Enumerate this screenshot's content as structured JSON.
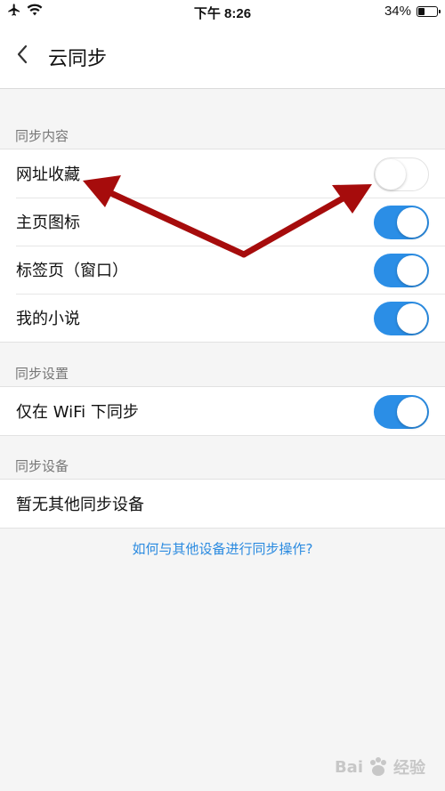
{
  "status_bar": {
    "time": "下午 8:26",
    "battery": "34%",
    "battery_level": 0.34
  },
  "nav": {
    "title": "云同步"
  },
  "sections": {
    "content": {
      "header": "同步内容",
      "items": [
        {
          "label": "网址收藏",
          "enabled": false
        },
        {
          "label": "主页图标",
          "enabled": true
        },
        {
          "label": "标签页（窗口）",
          "enabled": true
        },
        {
          "label": "我的小说",
          "enabled": true
        }
      ]
    },
    "settings": {
      "header": "同步设置",
      "items": [
        {
          "label": "仅在 WiFi 下同步",
          "enabled": true
        }
      ]
    },
    "devices": {
      "header": "同步设备",
      "empty_text": "暂无其他同步设备"
    }
  },
  "help_link": "如何与其他设备进行同步操作?",
  "watermark": {
    "brand": "Bai",
    "suffix": "经验"
  },
  "colors": {
    "accent": "#2b8ee6",
    "link": "#2a8ae0",
    "arrow": "#a60c0c"
  },
  "icons": [
    "airplane-icon",
    "wifi-icon",
    "battery-icon",
    "back-chevron-icon"
  ]
}
